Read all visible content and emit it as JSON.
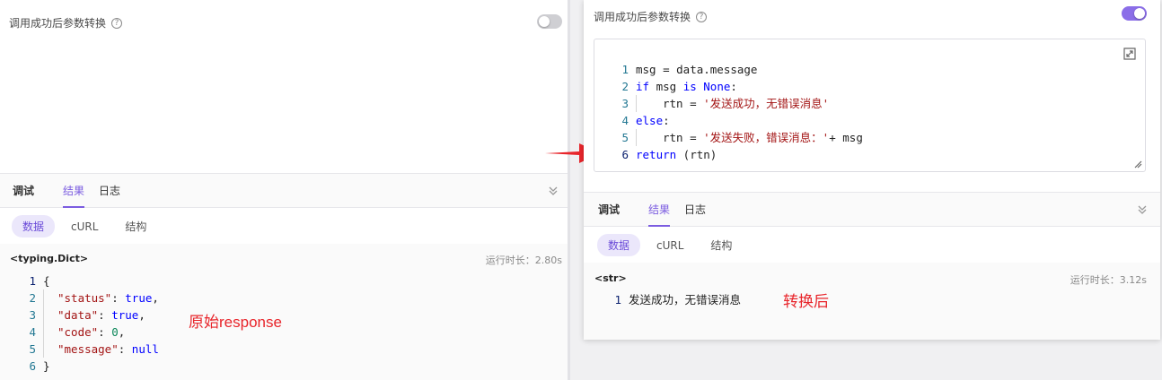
{
  "left": {
    "header_label": "调用成功后参数转换",
    "help_icon": "?",
    "toggle_state": "off",
    "tabs": [
      {
        "label": "调试",
        "state": "bold"
      },
      {
        "label": "结果",
        "state": "active"
      },
      {
        "label": "日志",
        "state": "normal"
      }
    ],
    "collapse_icon": "double-chevron-down-icon",
    "subtabs": [
      {
        "label": "数据",
        "active": true
      },
      {
        "label": "cURL",
        "active": false
      },
      {
        "label": "结构",
        "active": false
      }
    ],
    "result_type": "<typing.Dict>",
    "runtime": "运行时长：2.80s",
    "code_lines": [
      {
        "no": "1",
        "text": "{"
      },
      {
        "no": "2",
        "key": "\"status\"",
        "value": "true",
        "end": ","
      },
      {
        "no": "3",
        "key": "\"data\"",
        "value": "true",
        "end": ","
      },
      {
        "no": "4",
        "key": "\"code\"",
        "value": "0",
        "end": ","
      },
      {
        "no": "5",
        "key": "\"message\"",
        "value": "null",
        "end": ""
      },
      {
        "no": "6",
        "text": "}"
      }
    ],
    "annotation": "原始response"
  },
  "right": {
    "header_label": "调用成功后参数转换",
    "help_icon": "?",
    "toggle_state": "on",
    "editor_lines": [
      {
        "no": "1",
        "parts": [
          {
            "t": "msg = data.message",
            "c": "plain"
          }
        ]
      },
      {
        "no": "2",
        "parts": [
          {
            "t": "if",
            "c": "kw"
          },
          {
            "t": " msg ",
            "c": "plain"
          },
          {
            "t": "is None",
            "c": "kw"
          },
          {
            "t": ":",
            "c": "plain"
          }
        ]
      },
      {
        "no": "3",
        "indent": true,
        "parts": [
          {
            "t": "rtn = ",
            "c": "plain"
          },
          {
            "t": "'发送成功，无错误消息'",
            "c": "str"
          }
        ]
      },
      {
        "no": "4",
        "parts": [
          {
            "t": "else",
            "c": "kw"
          },
          {
            "t": ":",
            "c": "plain"
          }
        ]
      },
      {
        "no": "5",
        "indent": true,
        "parts": [
          {
            "t": "rtn = ",
            "c": "plain"
          },
          {
            "t": "'发送失败，错误消息：'",
            "c": "str"
          },
          {
            "t": "+ msg",
            "c": "plain"
          }
        ]
      },
      {
        "no": "6",
        "parts": [
          {
            "t": "return",
            "c": "kw"
          },
          {
            "t": " (rtn)",
            "c": "plain"
          }
        ]
      }
    ],
    "tabs": [
      {
        "label": "调试",
        "state": "bold"
      },
      {
        "label": "结果",
        "state": "active"
      },
      {
        "label": "日志",
        "state": "normal"
      }
    ],
    "collapse_icon": "double-chevron-down-icon",
    "subtabs": [
      {
        "label": "数据",
        "active": true
      },
      {
        "label": "cURL",
        "active": false
      },
      {
        "label": "结构",
        "active": false
      }
    ],
    "result_type": "<str>",
    "runtime": "运行时长：3.12s",
    "result_line_no": "1",
    "result_value": "发送成功，无错误消息",
    "annotation": "转换后"
  },
  "colors": {
    "accent": "#7b5ce0",
    "annotation": "#e8252b",
    "arrow": "#e8252b"
  }
}
